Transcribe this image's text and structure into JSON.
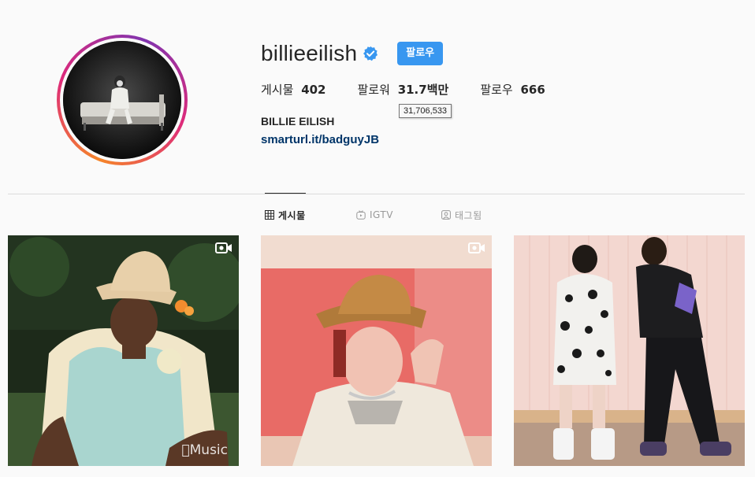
{
  "profile": {
    "username": "billieeilish",
    "follow_label": "팔로우",
    "stats": {
      "posts_label": "게시물",
      "posts_value": "402",
      "followers_label": "팔로워",
      "followers_value": "31.7백만",
      "following_label": "팔로우",
      "following_value": "666"
    },
    "followers_tooltip": "31,706,533",
    "full_name": "BILLIE EILISH",
    "bio_link": "smarturl.it/badguyJB"
  },
  "tabs": [
    {
      "label": "게시물",
      "icon": "grid-icon",
      "active": true
    },
    {
      "label": "IGTV",
      "icon": "igtv-icon",
      "active": false
    },
    {
      "label": "태그됨",
      "icon": "tagged-icon",
      "active": false
    }
  ],
  "posts": [
    {
      "type": "video",
      "overlay_text": "Music"
    },
    {
      "type": "video"
    },
    {
      "type": "photo"
    }
  ],
  "colors": {
    "accent": "#3897f0",
    "link": "#003569",
    "verified": "#3897f0"
  }
}
